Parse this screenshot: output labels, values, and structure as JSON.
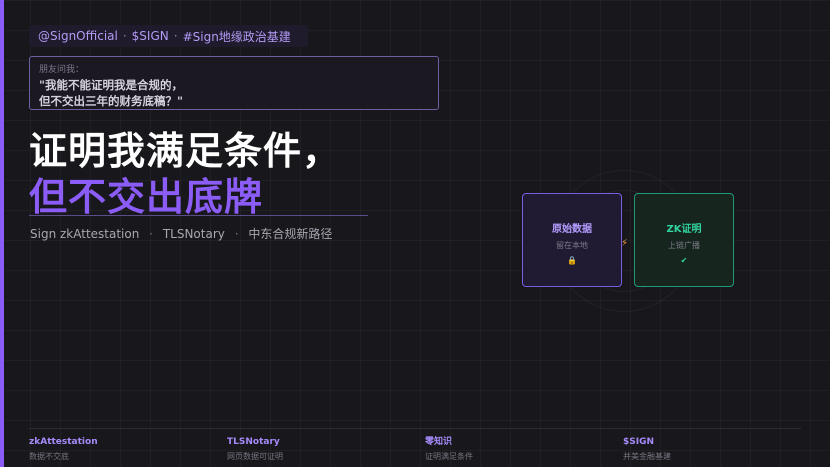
{
  "tagline": {
    "handle": "@SignOfficial",
    "ticker": "$SIGN",
    "hashtag": "#Sign地缘政治基建",
    "separator": "·"
  },
  "quote": {
    "label": "朋友问我：",
    "line1": "\"我能不能证明我是合规的，",
    "line2": "但不交出三年的财务底稿？\""
  },
  "headline": {
    "line1": "证明我满足条件，",
    "line2": "但不交出底牌"
  },
  "subtitle": {
    "part1": "Sign zkAttestation",
    "part2": "TLSNotary",
    "part3": "中东合规新路径",
    "separator": "·"
  },
  "diagram": {
    "raw_card": {
      "title": "原始数据",
      "subtitle": "留在本地",
      "icon": "lock-icon",
      "glyph": "🔒"
    },
    "arrow": {
      "icon": "arrow-right-icon",
      "glyph": "⚡"
    },
    "zk_card": {
      "title": "ZK证明",
      "subtitle": "上链广播",
      "icon": "check-icon",
      "glyph": "✔"
    }
  },
  "footer": [
    {
      "title": "zkAttestation",
      "subtitle": "数据不交底"
    },
    {
      "title": "TLSNotary",
      "subtitle": "网页数据可证明"
    },
    {
      "title": "零知识",
      "subtitle": "证明满足条件"
    },
    {
      "title": "$SIGN",
      "subtitle": "并美金融基建"
    }
  ],
  "colors": {
    "accent": "#8b5cf6",
    "green": "#32d49e",
    "orange": "#f2994a",
    "background": "#17171c"
  }
}
